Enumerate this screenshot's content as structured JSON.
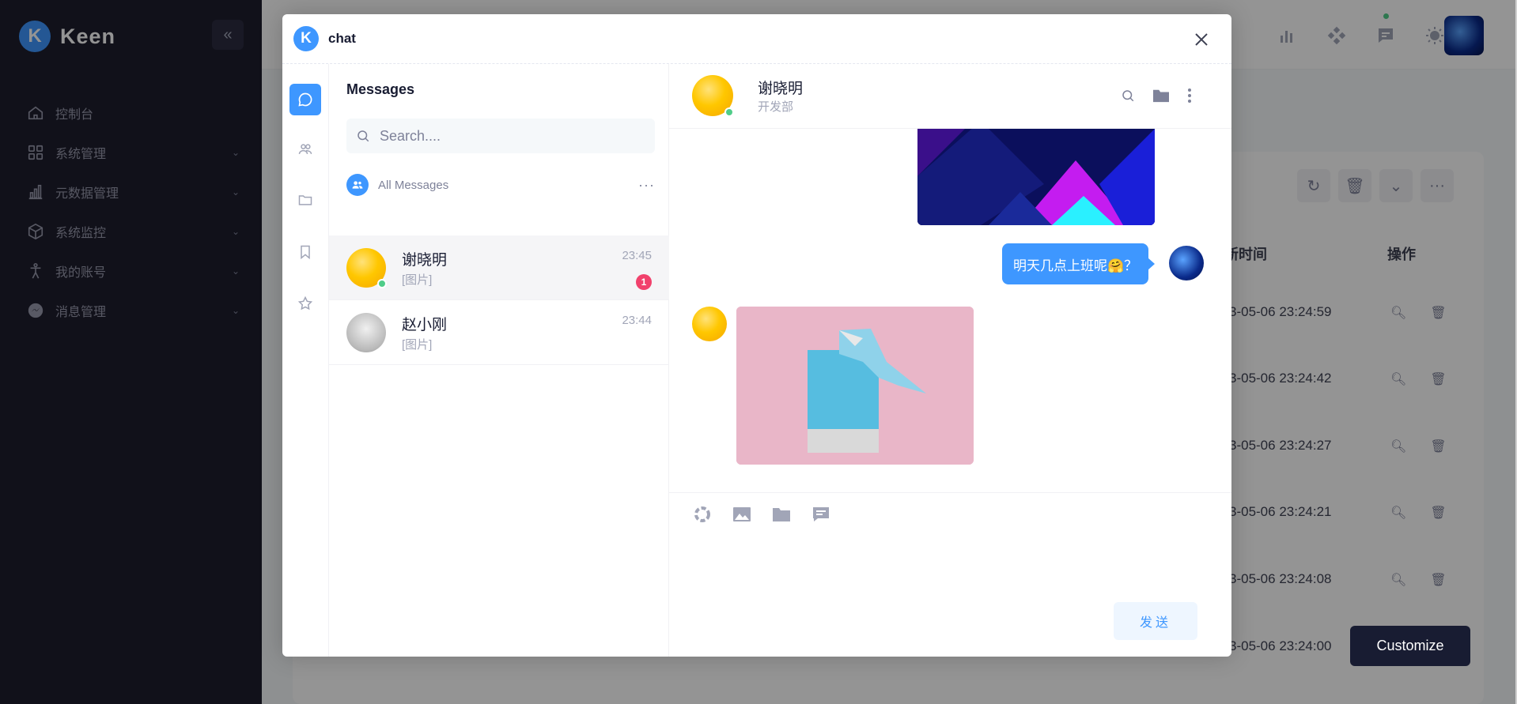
{
  "app": {
    "brand": "Keen",
    "logo_letter": "K",
    "accent_color": "#3e97ff"
  },
  "sidebar": {
    "items": [
      {
        "label": "控制台",
        "icon": "home-icon"
      },
      {
        "label": "系统管理",
        "icon": "grid-icon"
      },
      {
        "label": "元数据管理",
        "icon": "bar-chart-icon"
      },
      {
        "label": "系统监控",
        "icon": "box-icon"
      },
      {
        "label": "我的账号",
        "icon": "person-icon"
      },
      {
        "label": "消息管理",
        "icon": "messenger-icon"
      }
    ]
  },
  "table": {
    "col_time": "新时间",
    "col_actions": "操作",
    "times": [
      "3-05-06 23:24:59",
      "3-05-06 23:24:42",
      "3-05-06 23:24:27",
      "3-05-06 23:24:21",
      "3-05-06 23:24:08",
      "3-05-06 23:24:00"
    ]
  },
  "customize_label": "Customize",
  "modal": {
    "title": "chat",
    "logo_letter": "K",
    "list": {
      "title": "Messages",
      "search_placeholder": "Search....",
      "all_messages_label": "All Messages",
      "more_label": "···",
      "conversations": [
        {
          "name": "谢晓明",
          "preview": "[图片]",
          "time": "23:45",
          "unread": "1",
          "online": true,
          "active": true
        },
        {
          "name": "赵小刚",
          "preview": "[图片]",
          "time": "23:44",
          "unread": "",
          "online": false,
          "active": false
        }
      ]
    },
    "chat": {
      "name": "谢晓明",
      "department": "开发部",
      "outgoing_text": "明天几点上班呢🤗？",
      "send_label": "发送"
    }
  }
}
